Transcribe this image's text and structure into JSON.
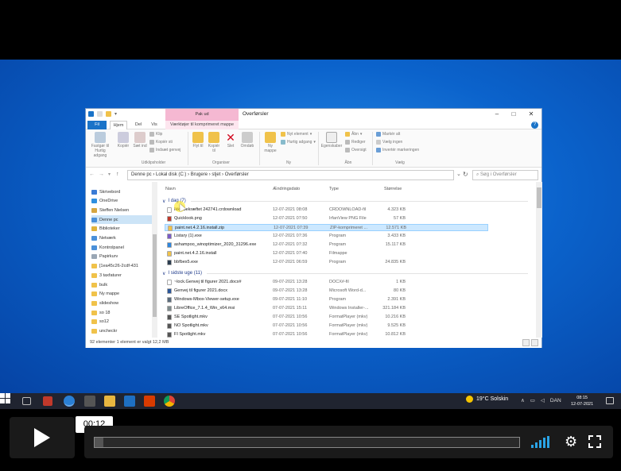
{
  "explorer": {
    "context_tab_header": "Pak ud",
    "title": "Overførsler",
    "tabs": {
      "file": "Fil",
      "home": "Hjem",
      "share": "Del",
      "view": "Vis",
      "context": "Værktøjer til komprimeret mappe"
    },
    "ribbon": {
      "pin": "Fastgør til Hurtig adgang",
      "copy": "Kopiér",
      "paste": "Sæt ind",
      "cut": "Klip",
      "copy_path": "Kopiér sti",
      "paste_shortcut": "Indsæt genvej",
      "group_clipboard": "Udklipsholder",
      "move_to": "Flyt til",
      "copy_to": "Kopiér til",
      "delete": "Slet",
      "rename": "Omdøb",
      "group_organize": "Organiser",
      "new_folder": "Ny mappe",
      "new_item": "Nyt element",
      "easy_access": "Hurtig adgang",
      "group_new": "Ny",
      "properties": "Egenskaber",
      "open": "Åbn",
      "edit": "Rediger",
      "history": "Oversigt",
      "group_open": "Åbn",
      "select_all": "Markér alt",
      "select_none": "Vælg ingen",
      "invert": "Invertér markeringen",
      "group_select": "Vælg"
    },
    "address": "Denne pc  ›  Lokal disk (C:)  ›  Brugere  ›  stjet  ›  Overførsler",
    "search_placeholder": "Søg i Overførsler",
    "nav": [
      {
        "label": "Skrivebord",
        "color": "#3a7bd5",
        "sel": false
      },
      {
        "label": "OneDrive",
        "color": "#2f8fe0",
        "sel": false
      },
      {
        "label": "Steffen Nielsen",
        "color": "#d6a640",
        "sel": false
      },
      {
        "label": "Denne pc",
        "color": "#4a90d9",
        "sel": true
      },
      {
        "label": "Biblioteker",
        "color": "#e0b33a",
        "sel": false
      },
      {
        "label": "Netværk",
        "color": "#4a90d9",
        "sel": false
      },
      {
        "label": "Kontrolpanel",
        "color": "#4a90d9",
        "sel": false
      },
      {
        "label": "Papirkurv",
        "color": "#9aa7b5",
        "sel": false
      },
      {
        "label": "[1ea45c26-2cdf-431",
        "color": "#f0c24a",
        "sel": false
      },
      {
        "label": "3 taxfaturer",
        "color": "#f0c24a",
        "sel": false
      },
      {
        "label": "bulk",
        "color": "#f0c24a",
        "sel": false
      },
      {
        "label": "Ny mappe",
        "color": "#f0c24a",
        "sel": false
      },
      {
        "label": "slideshow",
        "color": "#f0c24a",
        "sel": false
      },
      {
        "label": "so 18",
        "color": "#f0c24a",
        "sel": false
      },
      {
        "label": "so12",
        "color": "#f0c24a",
        "sel": false
      },
      {
        "label": "uncheckr",
        "color": "#f0c24a",
        "sel": false
      }
    ],
    "columns": {
      "name": "Navn",
      "date": "Ændringsdato",
      "type": "Type",
      "size": "Størrelse"
    },
    "groups": {
      "today": "I dag (7)",
      "week": "I sidste uge (11)"
    },
    "files_today": [
      {
        "name": "Ikke bekræftet 242741.crdownload",
        "date": "12-07-2021 08:08",
        "type": "CRDOWNLOAD-fil",
        "size": "4.323 KB",
        "color": "#ffffff",
        "sel": false
      },
      {
        "name": "Quicklook.png",
        "date": "12-07-2021 07:50",
        "type": "IrfanView PNG File",
        "size": "57 KB",
        "color": "#c0392b",
        "sel": false
      },
      {
        "name": "paint.net.4.2.16.install.zip",
        "date": "12-07-2021 07:39",
        "type": "ZIP-komprimeret ...",
        "size": "12.571 KB",
        "color": "#f0c24a",
        "sel": true
      },
      {
        "name": "Listary (1).exe",
        "date": "12-07-2021 07:36",
        "type": "Program",
        "size": "3.433 KB",
        "color": "#7a5cc8",
        "sel": false
      },
      {
        "name": "ashampoo_winoptimizer_2020_31296.exe",
        "date": "12-07-2021 07:32",
        "type": "Program",
        "size": "15.117 KB",
        "color": "#2e86de",
        "sel": false
      },
      {
        "name": "paint.net.4.2.16.install",
        "date": "12-07-2021 07:40",
        "type": "Filmappe",
        "size": "",
        "color": "#f0c24a",
        "sel": false
      },
      {
        "name": "bbfbex5.exe",
        "date": "12-07-2021 06:59",
        "type": "Program",
        "size": "24.835 KB",
        "color": "#2c3e50",
        "sel": false
      }
    ],
    "files_week": [
      {
        "name": "~lock.Genvej til figurer 2021.docx#",
        "date": "09-07-2021 13:28",
        "type": "DOCX#-fil",
        "size": "1 KB",
        "color": "#ffffff",
        "sel": false
      },
      {
        "name": "Genvej til figurer 2021.docx",
        "date": "09-07-2021 13:28",
        "type": "Microsoft Word-d...",
        "size": "80 KB",
        "color": "#2b579a",
        "sel": false
      },
      {
        "name": "Windows-Mbox-Viewer-setup.exe",
        "date": "09-07-2021 11:10",
        "type": "Program",
        "size": "2.391 KB",
        "color": "#5a6b7c",
        "sel": false
      },
      {
        "name": "LibreOffice_7.1.4_Win_x64.msi",
        "date": "07-07-2021 15:11",
        "type": "Windows Installer-...",
        "size": "321.184 KB",
        "color": "#7f8c8d",
        "sel": false
      },
      {
        "name": "SE Spotlight.mkv",
        "date": "07-07-2021 10:56",
        "type": "FormatPlayer (mkv)",
        "size": "10.216 KB",
        "color": "#555555",
        "sel": false
      },
      {
        "name": "NO Spotlight.mkv",
        "date": "07-07-2021 10:56",
        "type": "FormatPlayer (mkv)",
        "size": "9.525 KB",
        "color": "#555555",
        "sel": false
      },
      {
        "name": "FI Spotlight.mkv",
        "date": "07-07-2021 10:56",
        "type": "FormatPlayer (mkv)",
        "size": "10.812 KB",
        "color": "#555555",
        "sel": false
      }
    ],
    "status": "92 elementer     1 element er valgt  12,2 MB"
  },
  "taskbar": {
    "weather": "19°C  Solskin",
    "language": "DAN",
    "time": "08:15",
    "date": "12-07-2021"
  },
  "player": {
    "current_time": "00:12",
    "progress": 0.02
  }
}
